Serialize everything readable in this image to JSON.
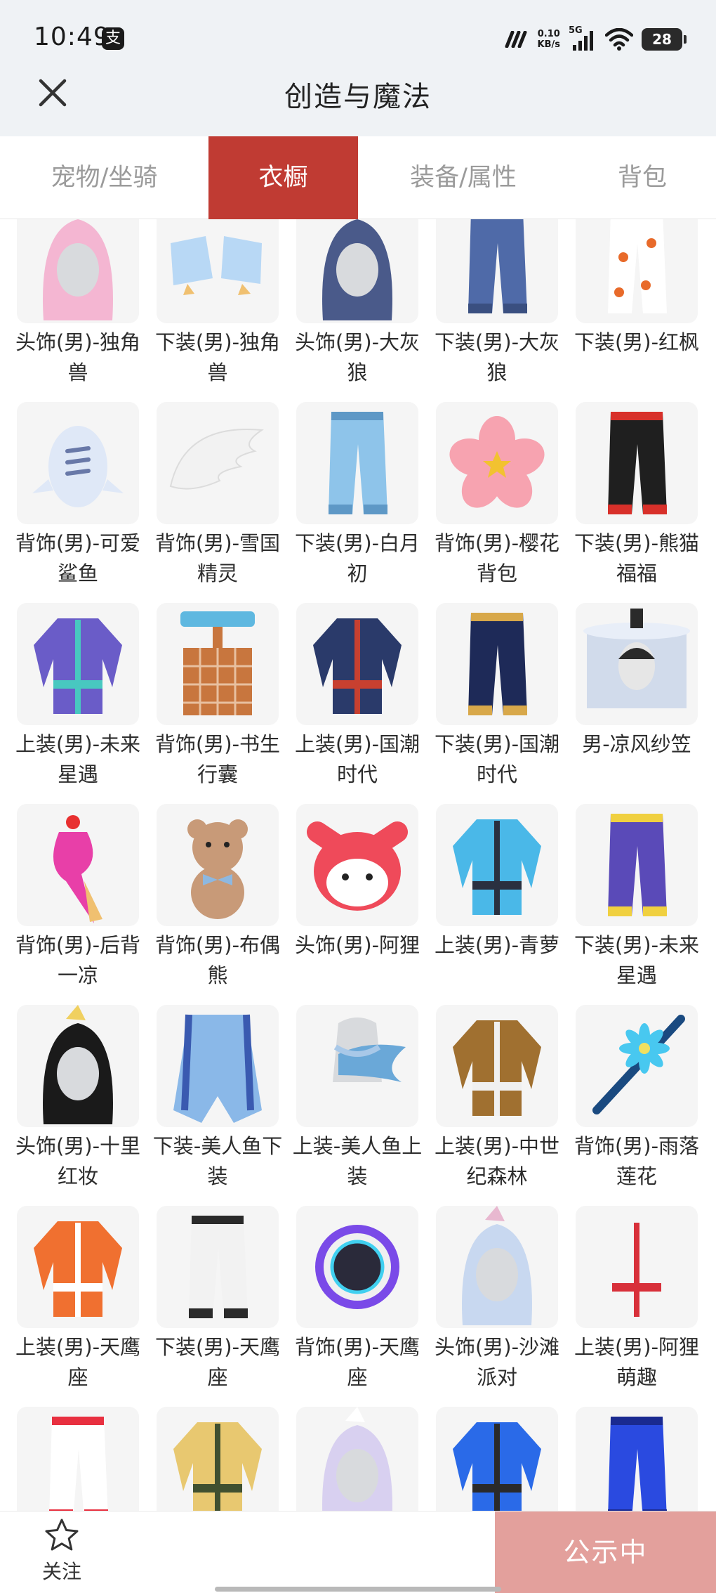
{
  "status_bar": {
    "time": "10:49",
    "notification_icon": "支",
    "net_speed_value": "0.10",
    "net_speed_unit": "KB/s",
    "network": "5G",
    "battery": "28"
  },
  "header": {
    "title": "创造与魔法"
  },
  "tabs": [
    {
      "label": "宠物/坐骑",
      "active": false
    },
    {
      "label": "衣橱",
      "active": true
    },
    {
      "label": "装备/属性",
      "active": false
    },
    {
      "label": "背包",
      "active": false
    }
  ],
  "items": [
    {
      "name": "头饰(男)-独角兽",
      "icon": "unicorn-hood-icon",
      "colors": [
        "#f4b6d2",
        "#ffffff"
      ]
    },
    {
      "name": "下装(男)-独角兽",
      "icon": "shoes-icon",
      "colors": [
        "#b8d8f5",
        "#f0c070"
      ]
    },
    {
      "name": "头饰(男)-大灰狼",
      "icon": "wolf-hood-icon",
      "colors": [
        "#4a5a8a",
        "#e04040"
      ]
    },
    {
      "name": "下装(男)-大灰狼",
      "icon": "pants-icon",
      "colors": [
        "#4f6aa8",
        "#3a4f80"
      ]
    },
    {
      "name": "下装(男)-红枫",
      "icon": "maple-pants-icon",
      "colors": [
        "#ffffff",
        "#e86a2a"
      ]
    },
    {
      "name": "背饰(男)-可爱鲨鱼",
      "icon": "shark-backpack-icon",
      "colors": [
        "#dfe8f7",
        "#6878a8"
      ]
    },
    {
      "name": "背饰(男)-雪国精灵",
      "icon": "wings-icon",
      "colors": [
        "#f2f2f2",
        "#dcdcdc"
      ]
    },
    {
      "name": "下装(男)-白月初",
      "icon": "pants-icon",
      "colors": [
        "#8ec4ea",
        "#5e98c6"
      ]
    },
    {
      "name": "背饰(男)-樱花背包",
      "icon": "sakura-backpack-icon",
      "colors": [
        "#f7a3b0",
        "#f2c230"
      ]
    },
    {
      "name": "下装(男)-熊猫福福",
      "icon": "pants-icon",
      "colors": [
        "#1f1f1f",
        "#d8302a"
      ]
    },
    {
      "name": "上装(男)-未来星遇",
      "icon": "jacket-icon",
      "colors": [
        "#6a5cc8",
        "#48c8c0"
      ]
    },
    {
      "name": "背饰(男)-书生行囊",
      "icon": "book-box-icon",
      "colors": [
        "#c8763e",
        "#5fb8e0"
      ]
    },
    {
      "name": "上装(男)-国潮时代",
      "icon": "robe-icon",
      "colors": [
        "#2a3a6a",
        "#c84030"
      ]
    },
    {
      "name": "下装(男)-国潮时代",
      "icon": "pants-icon",
      "colors": [
        "#1e2a58",
        "#d8a84a"
      ]
    },
    {
      "name": "男-凉风纱笠",
      "icon": "veil-hat-icon",
      "colors": [
        "#c8d4e8",
        "#2a2a2a"
      ]
    },
    {
      "name": "背饰(男)-后背一凉",
      "icon": "ice-cream-icon",
      "colors": [
        "#e83fa8",
        "#f0c070"
      ]
    },
    {
      "name": "背饰(男)-布偶熊",
      "icon": "teddy-bear-icon",
      "colors": [
        "#c89a78",
        "#8eb8e0"
      ]
    },
    {
      "name": "头饰(男)-阿狸",
      "icon": "fox-head-icon",
      "colors": [
        "#ef4a5a",
        "#ffffff"
      ]
    },
    {
      "name": "上装(男)-青萝",
      "icon": "robe-icon",
      "colors": [
        "#4ab8e8",
        "#2a3040"
      ]
    },
    {
      "name": "下装(男)-未来星遇",
      "icon": "pants-icon",
      "colors": [
        "#5a4ab8",
        "#f0d040"
      ]
    },
    {
      "name": "头饰(男)-十里红妆",
      "icon": "hair-icon",
      "colors": [
        "#1a1a1a",
        "#f0d060"
      ]
    },
    {
      "name": "下装-美人鱼下装",
      "icon": "mermaid-skirt-icon",
      "colors": [
        "#8ab8e8",
        "#3a5ab0"
      ]
    },
    {
      "name": "上装-美人鱼上装",
      "icon": "mermaid-top-icon",
      "colors": [
        "#a8c8e8",
        "#6aa8d8"
      ]
    },
    {
      "name": "上装(男)-中世纪森林",
      "icon": "vest-icon",
      "colors": [
        "#a07030",
        "#f0f0f0"
      ]
    },
    {
      "name": "背饰(男)-雨落莲花",
      "icon": "flute-icon",
      "colors": [
        "#48c8f0",
        "#1a4a80"
      ]
    },
    {
      "name": "上装(男)-天鹰座",
      "icon": "jacket-icon",
      "colors": [
        "#f07030",
        "#ffffff"
      ]
    },
    {
      "name": "下装(男)-天鹰座",
      "icon": "pants-icon",
      "colors": [
        "#f2f2f2",
        "#2a2a2a"
      ]
    },
    {
      "name": "背饰(男)-天鹰座",
      "icon": "orb-backpack-icon",
      "colors": [
        "#7a4ae8",
        "#40d0f0"
      ]
    },
    {
      "name": "头饰(男)-沙滩派对",
      "icon": "hair-icon",
      "colors": [
        "#c8d8f0",
        "#e8b8d0"
      ]
    },
    {
      "name": "上装(男)-阿狸萌趣",
      "icon": "jacket-icon",
      "colors": [
        "#f5f5f5",
        "#d8303a"
      ]
    },
    {
      "name": "",
      "icon": "pants-icon",
      "colors": [
        "#ffffff",
        "#e83040"
      ]
    },
    {
      "name": "",
      "icon": "vest-icon",
      "colors": [
        "#e8c870",
        "#405030"
      ]
    },
    {
      "name": "",
      "icon": "hair-icon",
      "colors": [
        "#d8d0f0",
        "#ffffff"
      ]
    },
    {
      "name": "",
      "icon": "robe-icon",
      "colors": [
        "#2a6ae8",
        "#2a2a2a"
      ]
    },
    {
      "name": "",
      "icon": "pants-icon",
      "colors": [
        "#2a4ae0",
        "#1a2a90"
      ]
    }
  ],
  "bottom_bar": {
    "follow_label": "关注",
    "publicity_label": "公示中"
  },
  "colors": {
    "accent": "#c03b33",
    "publicity": "#e3a09c",
    "tab_inactive": "#9b9b9b"
  }
}
